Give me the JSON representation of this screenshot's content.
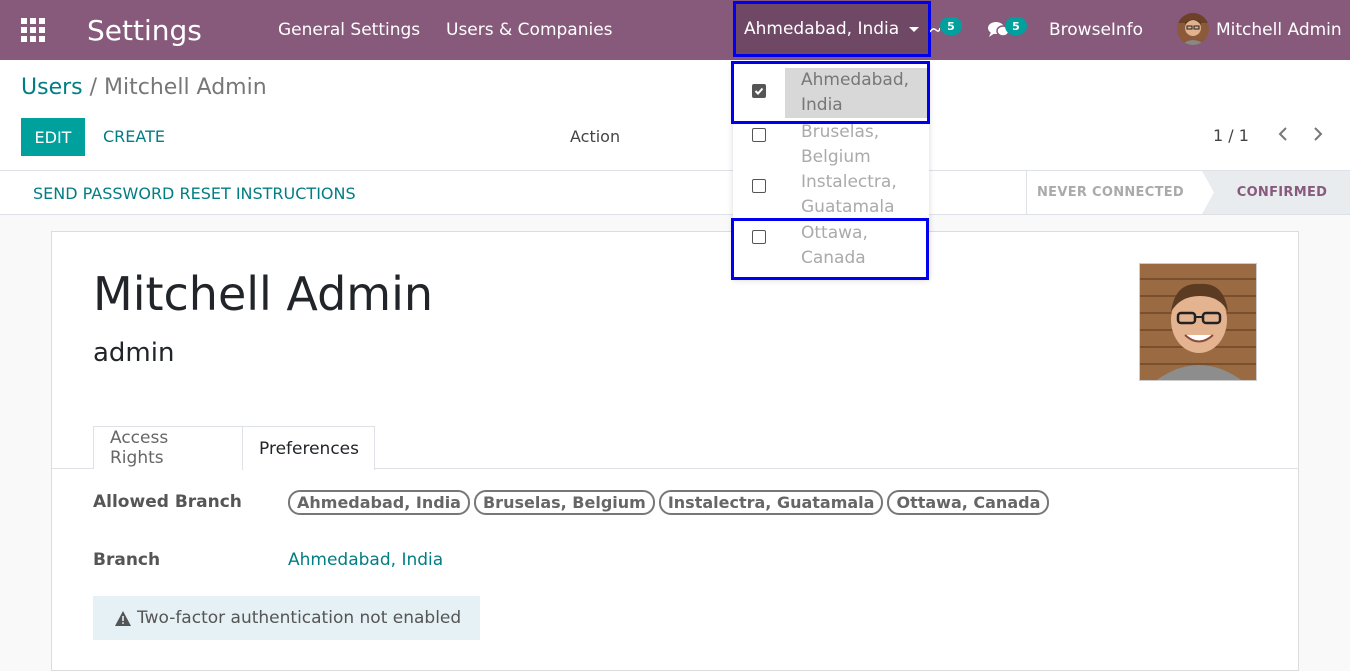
{
  "navbar": {
    "app_title": "Settings",
    "menu": [
      "General Settings",
      "Users & Companies"
    ],
    "branch_selector": "Ahmedabad, India",
    "activity_badge": "5",
    "chat_badge": "5",
    "company": "BrowseInfo",
    "user": "Mitchell Admin"
  },
  "breadcrumb": {
    "parent": "Users",
    "separator": "/",
    "current": "Mitchell Admin"
  },
  "buttons": {
    "edit": "EDIT",
    "create": "CREATE",
    "action": "Action"
  },
  "pager": "1 / 1",
  "statusbar": {
    "reset": "SEND PASSWORD RESET INSTRUCTIONS",
    "stage_never": "NEVER CONNECTED",
    "stage_confirmed": "CONFIRMED"
  },
  "record": {
    "name": "Mitchell Admin",
    "login": "admin"
  },
  "tabs": [
    "Access Rights",
    "Preferences"
  ],
  "fields": {
    "allowed_branch_label": "Allowed Branch",
    "allowed_branches": [
      "Ahmedabad, India",
      "Bruselas, Belgium",
      "Instalectra, Guatamala",
      "Ottawa, Canada"
    ],
    "branch_label": "Branch",
    "branch_value": "Ahmedabad, India"
  },
  "tfa_notice": "Two-factor authentication not enabled",
  "dropdown": [
    {
      "line1": "Ahmedabad,",
      "line2": "India",
      "checked": true
    },
    {
      "line1": "Bruselas,",
      "line2": "Belgium",
      "checked": false
    },
    {
      "line1": "Instalectra,",
      "line2": "Guatamala",
      "checked": false
    },
    {
      "line1": "Ottawa,",
      "line2": "Canada",
      "checked": false
    }
  ],
  "colors": {
    "brand": "#875a7b",
    "primary": "#00a09d",
    "link": "#017e84",
    "highlight": "#0000ee"
  }
}
